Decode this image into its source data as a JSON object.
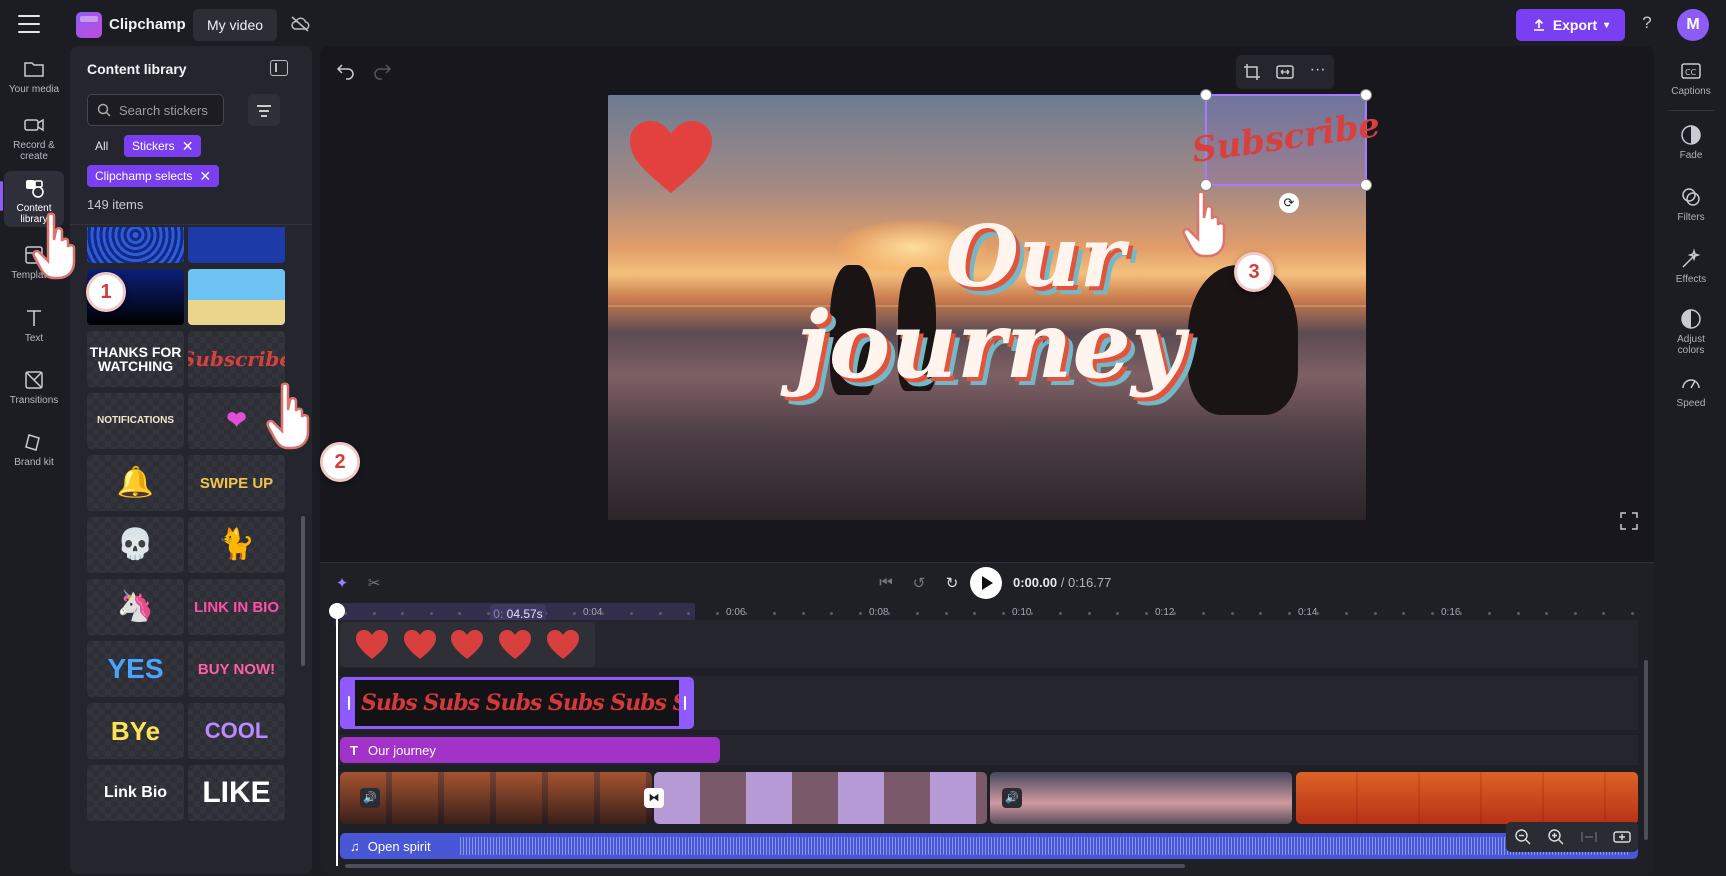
{
  "app": {
    "brand": "Clipchamp",
    "project_name": "My video",
    "export_label": "Export",
    "help_label": "?",
    "avatar_initial": "M"
  },
  "left_nav": [
    {
      "label": "Your media",
      "icon": "folder-icon"
    },
    {
      "label": "Record & create",
      "icon": "camera-icon"
    },
    {
      "label": "Content library",
      "icon": "shapes-icon",
      "active": true
    },
    {
      "label": "Templates",
      "icon": "template-icon"
    },
    {
      "label": "Text",
      "icon": "text-icon"
    },
    {
      "label": "Transitions",
      "icon": "transitions-icon"
    },
    {
      "label": "Brand kit",
      "icon": "brand-kit-icon"
    }
  ],
  "library": {
    "title": "Content library",
    "search_placeholder": "Search stickers",
    "chip_all": "All",
    "chip_stickers": "Stickers",
    "chip_selects": "Clipchamp selects",
    "count": "149 items",
    "stickers": [
      {
        "name": "blue-pattern",
        "text": ""
      },
      {
        "name": "fish",
        "text": ""
      },
      {
        "name": "night-scene",
        "text": ""
      },
      {
        "name": "beach-scene",
        "text": ""
      },
      {
        "name": "thanks-for-watching",
        "text": "THANKS FOR WATCHING"
      },
      {
        "name": "subscribe",
        "text": "Subscribe"
      },
      {
        "name": "notifications",
        "text": "NOTIFICATIONS"
      },
      {
        "name": "pink-heart",
        "text": "❤"
      },
      {
        "name": "bell",
        "text": "🔔"
      },
      {
        "name": "swipe-up",
        "text": "SWIPE UP"
      },
      {
        "name": "skull",
        "text": "💀"
      },
      {
        "name": "black-cat",
        "text": "🐈"
      },
      {
        "name": "unicorn",
        "text": "🦄"
      },
      {
        "name": "link-in-bio",
        "text": "LINK IN BIO"
      },
      {
        "name": "yes",
        "text": "YES"
      },
      {
        "name": "buy-now",
        "text": "BUY NOW!"
      },
      {
        "name": "bye",
        "text": "BYe"
      },
      {
        "name": "cool",
        "text": "COOL"
      },
      {
        "name": "link-bio",
        "text": "Link Bio"
      },
      {
        "name": "like",
        "text": "LIKE"
      }
    ]
  },
  "preview": {
    "overlay_line1": "Our",
    "overlay_line2": "journey",
    "sticker_text": "Subscribe"
  },
  "playback": {
    "current": "0:00.00",
    "duration": "/ 0:16.77"
  },
  "timeline": {
    "playhead_prefix": "0:",
    "playhead_time": "04.57s",
    "ruler_labels": [
      "0:04",
      "0:06",
      "0:08",
      "0:10",
      "0:12",
      "0:14",
      "0:16"
    ],
    "subscribe_clip_text": "Subs Subs Subs Subs Subs Subs Subs",
    "text_clip_label": "Our journey",
    "audio_clip_label": "Open spirit"
  },
  "right_panel": [
    {
      "label": "Captions",
      "icon": "captions-icon"
    },
    {
      "label": "Fade",
      "icon": "fade-icon"
    },
    {
      "label": "Filters",
      "icon": "filters-icon"
    },
    {
      "label": "Effects",
      "icon": "effects-icon"
    },
    {
      "label": "Adjust colors",
      "icon": "adjust-colors-icon"
    },
    {
      "label": "Speed",
      "icon": "speed-icon"
    }
  ],
  "annotations": [
    "1",
    "2",
    "3"
  ],
  "colors": {
    "accent": "#7b3ff2",
    "text_clip": "#a232c8",
    "audio_clip": "#4757d6",
    "sticker_red": "#d8403e"
  }
}
